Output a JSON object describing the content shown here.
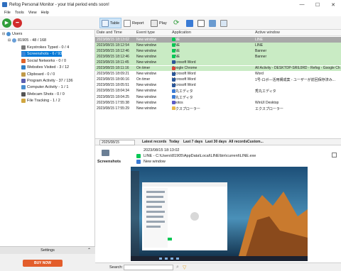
{
  "window": {
    "title": "Refog Personal Monitor - your trial period ends soon!",
    "controls": [
      "—",
      "☐",
      "✕"
    ]
  },
  "menu": [
    "File",
    "Tools",
    "View",
    "Help"
  ],
  "toolbar": {
    "start_label": "Start monitoring",
    "stop_label": "Stop monitoring",
    "table_label": "Table",
    "report_label": "Report",
    "play_label": "Play"
  },
  "sidebar": {
    "root": "Users",
    "user": "81905 - 48 / 168",
    "items": [
      {
        "label": "Keystrokes Typed - 0 / 4",
        "icon": "keyboard-icon",
        "color": "#7a7a7a",
        "selected": false
      },
      {
        "label": "Screenshots - 6 / 93",
        "icon": "screenshot-icon",
        "color": "#3b86d8",
        "selected": true
      },
      {
        "label": "Social Networks - 0 / 0",
        "icon": "social-icon",
        "color": "#e0632a",
        "selected": false
      },
      {
        "label": "Websites Visited - 3 / 12",
        "icon": "globe-icon",
        "color": "#2f80c8",
        "selected": false
      },
      {
        "label": "Clipboard - 0 / 0",
        "icon": "clipboard-icon",
        "color": "#c09a4a",
        "selected": false
      },
      {
        "label": "Program Activity - 37 / 136",
        "icon": "program-icon",
        "color": "#5a5fb0",
        "selected": false
      },
      {
        "label": "Computer Activity - 1 / 1",
        "icon": "computer-icon",
        "color": "#4a8fd0",
        "selected": false
      },
      {
        "label": "Webcam Shots - 0 / 0",
        "icon": "webcam-icon",
        "color": "#555",
        "selected": false
      },
      {
        "label": "File Tracking - 1 / 2",
        "icon": "file-icon",
        "color": "#d0a640",
        "selected": false
      }
    ],
    "settings_label": "Settings",
    "buy_label": "BUY NOW"
  },
  "grid": {
    "columns": [
      "Date and Time",
      "Event type",
      "Application",
      "Active window"
    ],
    "rows": [
      {
        "date": "2023/08/15 18:13:02",
        "event": "New window",
        "app": "LINE",
        "window": "LINE",
        "style": "selrow",
        "appColor": "#06c755"
      },
      {
        "date": "2023/08/15 18:12:54",
        "event": "New window",
        "app": "LINE",
        "window": "LINE",
        "style": "green",
        "appColor": "#06c755"
      },
      {
        "date": "2023/08/15 18:12:46",
        "event": "New window",
        "app": "LINE",
        "window": "Banner",
        "style": "green",
        "appColor": "#06c755"
      },
      {
        "date": "2023/08/15 18:12:46",
        "event": "New window",
        "app": "LINE",
        "window": "Banner",
        "style": "green",
        "appColor": "#06c755"
      },
      {
        "date": "2023/08/15 18:11:45",
        "event": "New window",
        "app": "Microsoft Word",
        "window": "",
        "style": "green",
        "appColor": "#2b579a"
      },
      {
        "date": "2023/08/15 18:11:16",
        "event": "On timer",
        "app": "Google Chrome",
        "window": "All Activity - DESKTOP-SRIL0RD - Refog - Google Chro...",
        "style": "green",
        "appColor": "#db4437"
      },
      {
        "date": "2023/08/15 18:09:21",
        "event": "New window",
        "app": "Microsoft Word",
        "window": "Word",
        "style": "",
        "appColor": "#2b579a"
      },
      {
        "date": "2023/08/15 18:06:16",
        "event": "On timer",
        "app": "Microsoft Word",
        "window": "1号-ロボ―活用構成案 - ユーザーが前回保存済み...",
        "style": "",
        "appColor": "#2b579a"
      },
      {
        "date": "2023/08/15 18:05:51",
        "event": "New window",
        "app": "Microsoft Word",
        "window": "",
        "style": "",
        "appColor": "#2b579a"
      },
      {
        "date": "2023/08/15 18:04:34",
        "event": "New window",
        "app": "秀丸エディタ",
        "window": "秀丸エディタ",
        "style": "",
        "appColor": "#3a7bd5"
      },
      {
        "date": "2023/08/15 18:04:25",
        "event": "New window",
        "app": "秀丸エディタ",
        "window": "",
        "style": "",
        "appColor": "#3a7bd5"
      },
      {
        "date": "2023/08/15 17:55:38",
        "event": "New window",
        "app": "Photos",
        "window": "WinUI Desktop",
        "style": "",
        "appColor": "#5c5cc8"
      },
      {
        "date": "2023/08/15 17:55:29",
        "event": "New window",
        "app": "エクスプローラー",
        "window": "エクスプローラー",
        "style": "",
        "appColor": "#e8b84a"
      }
    ]
  },
  "filter": {
    "date": "2025/08/15",
    "options": [
      "Latest records",
      "Today",
      "Last 7 days",
      "Last 30 days",
      "All records",
      "Custom..."
    ]
  },
  "detail": {
    "section_label": "Screenshots",
    "timestamp": "2023/08/15 18:13:02",
    "path": "LINE - C:\\Users\\81905\\AppData\\Local\\LINE\\bin\\current\\LINE.exe",
    "event": "New window"
  },
  "search": {
    "label": "Search:",
    "placeholder": ""
  }
}
